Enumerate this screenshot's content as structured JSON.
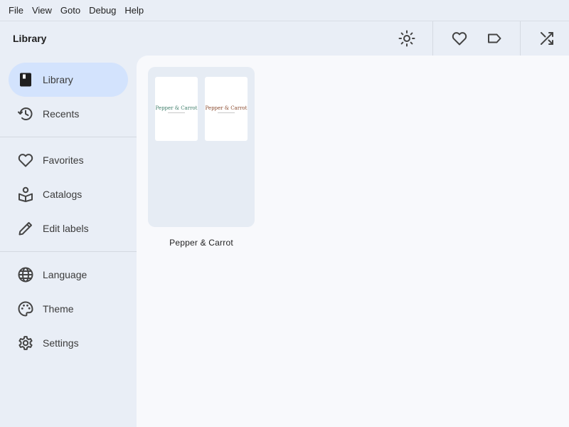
{
  "menubar": {
    "items": [
      "File",
      "View",
      "Goto",
      "Debug",
      "Help"
    ]
  },
  "toolbar": {
    "title": "Library",
    "buttons": [
      {
        "icon": "brightness-icon"
      },
      {
        "icon": "heart-icon"
      },
      {
        "icon": "label-icon"
      },
      {
        "icon": "shuffle-icon"
      }
    ]
  },
  "sidebar": {
    "items": [
      {
        "label": "Library",
        "icon": "library-book-icon",
        "active": true
      },
      {
        "label": "Recents",
        "icon": "history-icon"
      },
      {
        "label": "Favorites",
        "icon": "heart-outline-icon"
      },
      {
        "label": "Catalogs",
        "icon": "catalog-icon"
      },
      {
        "label": "Edit labels",
        "icon": "pencil-icon"
      },
      {
        "label": "Language",
        "icon": "globe-icon"
      },
      {
        "label": "Theme",
        "icon": "palette-icon"
      },
      {
        "label": "Settings",
        "icon": "gear-icon"
      }
    ]
  },
  "library": {
    "items": [
      {
        "title": "Pepper & Carrot",
        "covers": [
          {
            "text": "Pepper & Carrot",
            "color": "#3e7d6a"
          },
          {
            "text": "Pepper & Carrot",
            "color": "#8a4b2f"
          }
        ]
      }
    ]
  },
  "colors": {
    "accent": "#d3e3fd",
    "background": "#e9eef6",
    "content": "#f8f9fc"
  }
}
